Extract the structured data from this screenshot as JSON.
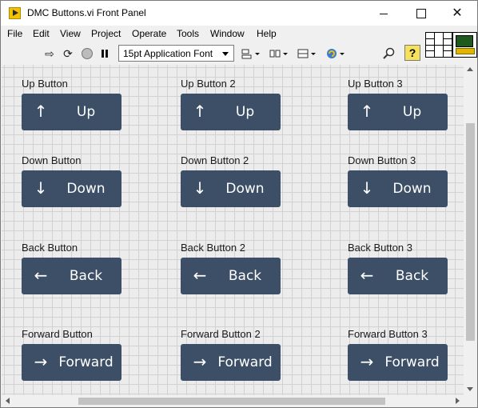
{
  "window": {
    "title": "DMC Buttons.vi Front Panel",
    "close_glyph": "✕"
  },
  "menu": [
    "File",
    "Edit",
    "View",
    "Project",
    "Operate",
    "Tools",
    "Window",
    "Help"
  ],
  "toolbar": {
    "font_select": "15pt Application Font",
    "icons": [
      "run-arrow-icon",
      "run-continuously-icon",
      "abort-icon",
      "pause-icon",
      "align-objects-icon",
      "distribute-objects-icon",
      "resize-objects-icon",
      "reorder-icon",
      "search-icon",
      "context-help-icon"
    ],
    "help_glyph": "?"
  },
  "controls": [
    {
      "label": "Up Button",
      "text": "Up",
      "arrow": "↑"
    },
    {
      "label": "Up Button 2",
      "text": "Up",
      "arrow": "↑"
    },
    {
      "label": "Up Button 3",
      "text": "Up",
      "arrow": "↑"
    },
    {
      "label": "Down Button",
      "text": "Down",
      "arrow": "↓"
    },
    {
      "label": "Down Button 2",
      "text": "Down",
      "arrow": "↓"
    },
    {
      "label": "Down Button 3",
      "text": "Down",
      "arrow": "↓"
    },
    {
      "label": "Back Button",
      "text": "Back",
      "arrow": "←"
    },
    {
      "label": "Back Button 2",
      "text": "Back",
      "arrow": "←"
    },
    {
      "label": "Back Button 3",
      "text": "Back",
      "arrow": "←"
    },
    {
      "label": "Forward Button",
      "text": "Forward",
      "arrow": "→"
    },
    {
      "label": "Forward Button 2",
      "text": "Forward",
      "arrow": "→"
    },
    {
      "label": "Forward Button 3",
      "text": "Forward",
      "arrow": "→"
    }
  ],
  "colors": {
    "button_bg": "#3c4f66",
    "button_text": "#ffffff",
    "panel_bg": "#ececec",
    "grid": "#d2d2d2"
  }
}
